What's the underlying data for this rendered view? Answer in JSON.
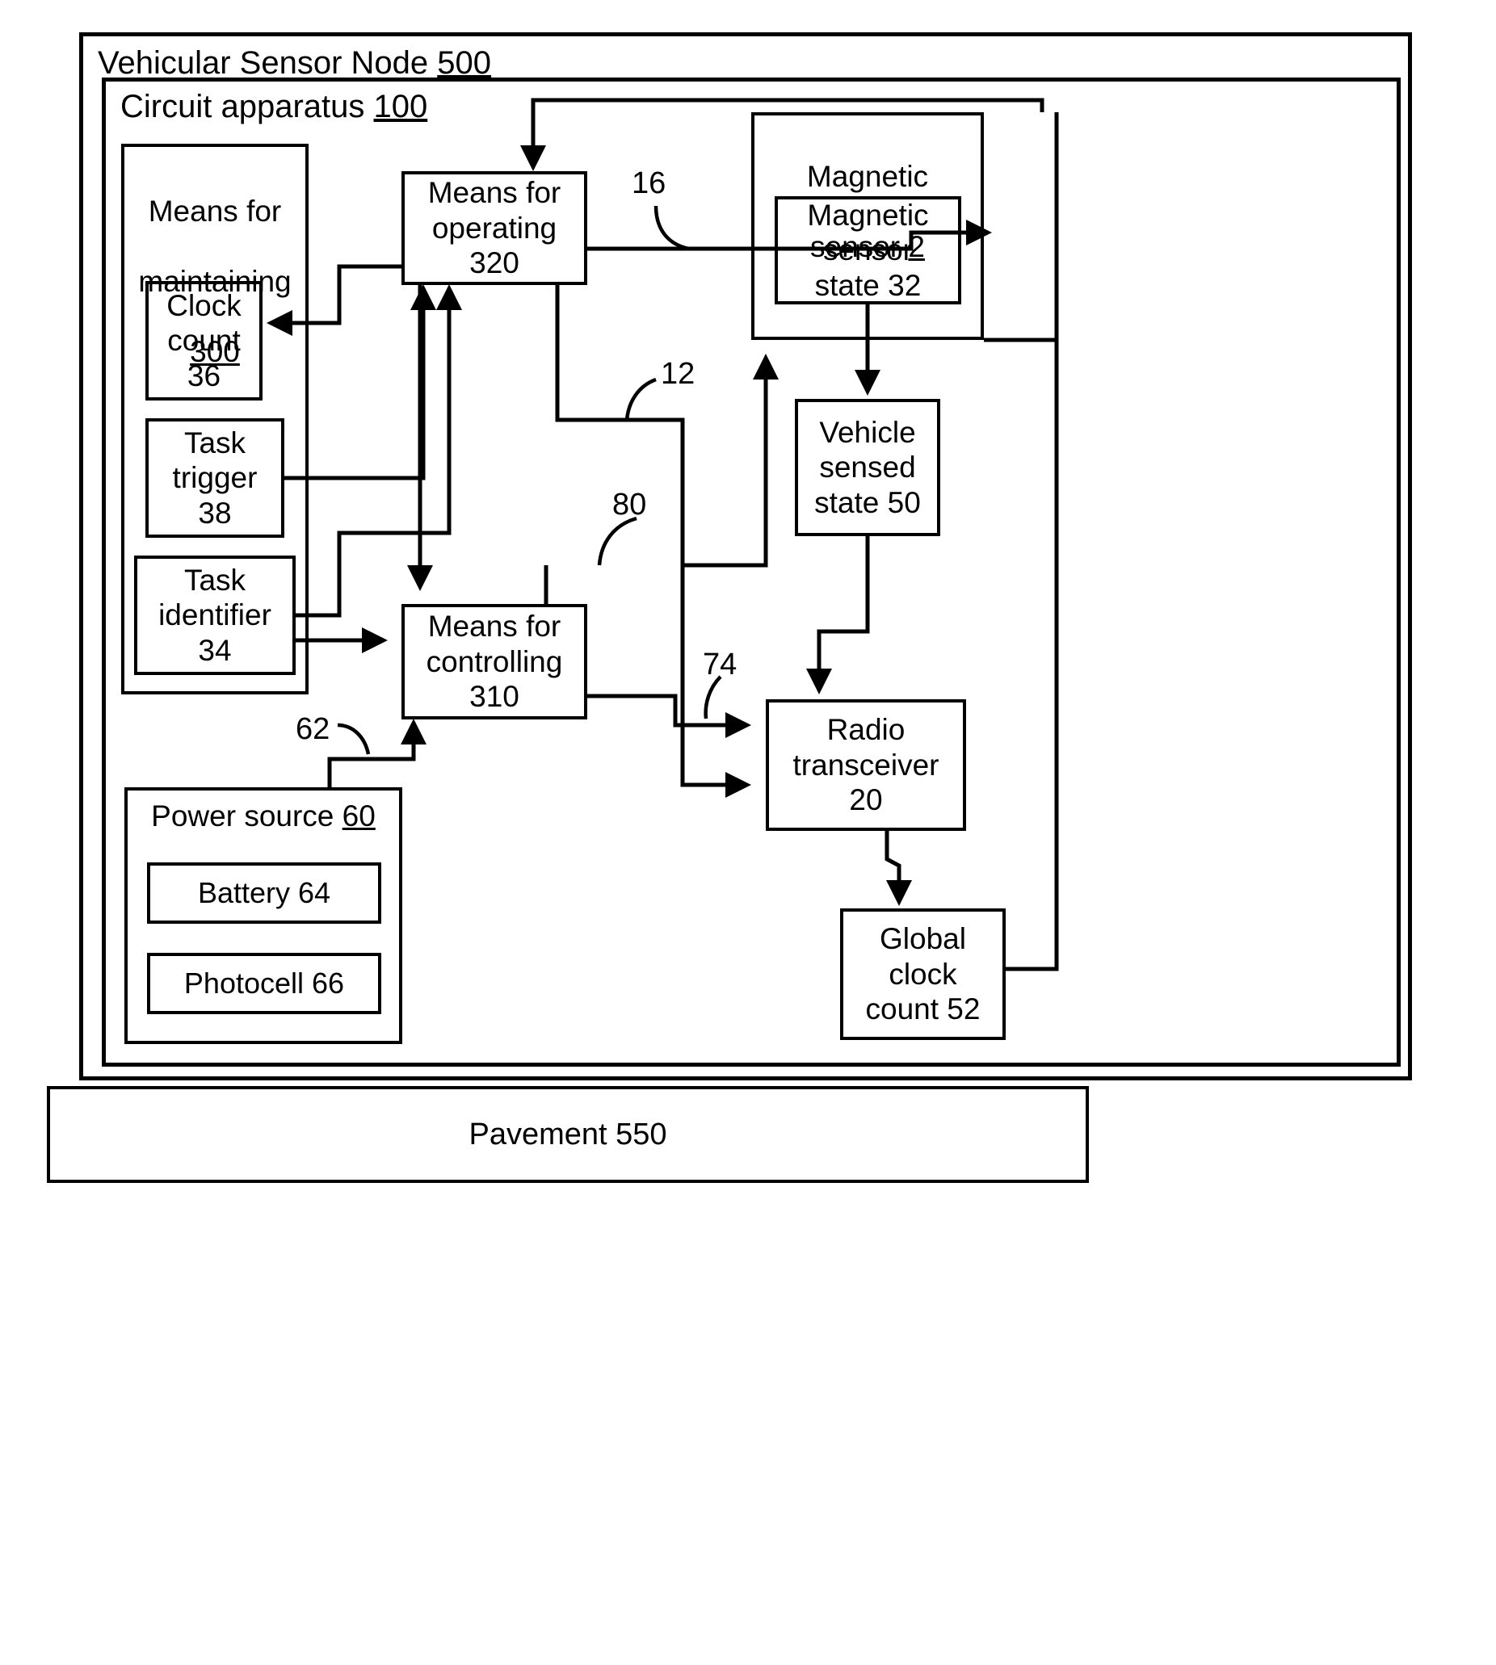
{
  "figure": {
    "node_frame_label": "Vehicular Sensor Node ",
    "node_frame_number": "500",
    "circuit_frame_label": "Circuit apparatus ",
    "circuit_frame_number": "100",
    "pavement_label": "Pavement 550"
  },
  "blocks": {
    "means_maintaining": {
      "line1": "Means for",
      "line2": "maintaining",
      "number": "300"
    },
    "clock_count": {
      "text": "Clock\ncount\n36"
    },
    "task_trigger": {
      "text": "Task\ntrigger\n38"
    },
    "task_identifier": {
      "text": "Task\nidentifier\n34"
    },
    "means_operating": {
      "text": "Means for\noperating\n320"
    },
    "means_controlling": {
      "text": "Means for\ncontrolling\n310"
    },
    "power_source": {
      "label": "Power source ",
      "number": "60"
    },
    "battery": {
      "text": "Battery 64"
    },
    "photocell": {
      "text": "Photocell 66"
    },
    "magnetic_sensor": {
      "line1": "Magnetic",
      "line2": "sensor ",
      "number": "2"
    },
    "magnetic_sensor_state": {
      "text": "Magnetic\nsensor\nstate 32"
    },
    "vehicle_sensed_state": {
      "text": "Vehicle\nsensed\nstate 50"
    },
    "radio_transceiver": {
      "text": "Radio\ntransceiver\n20"
    },
    "global_clock_count": {
      "text": "Global\nclock\ncount 52"
    }
  },
  "reference_numerals": {
    "n16": "16",
    "n12": "12",
    "n80": "80",
    "n74": "74",
    "n62": "62"
  },
  "colors": {
    "line": "#000000",
    "background": "#ffffff"
  }
}
